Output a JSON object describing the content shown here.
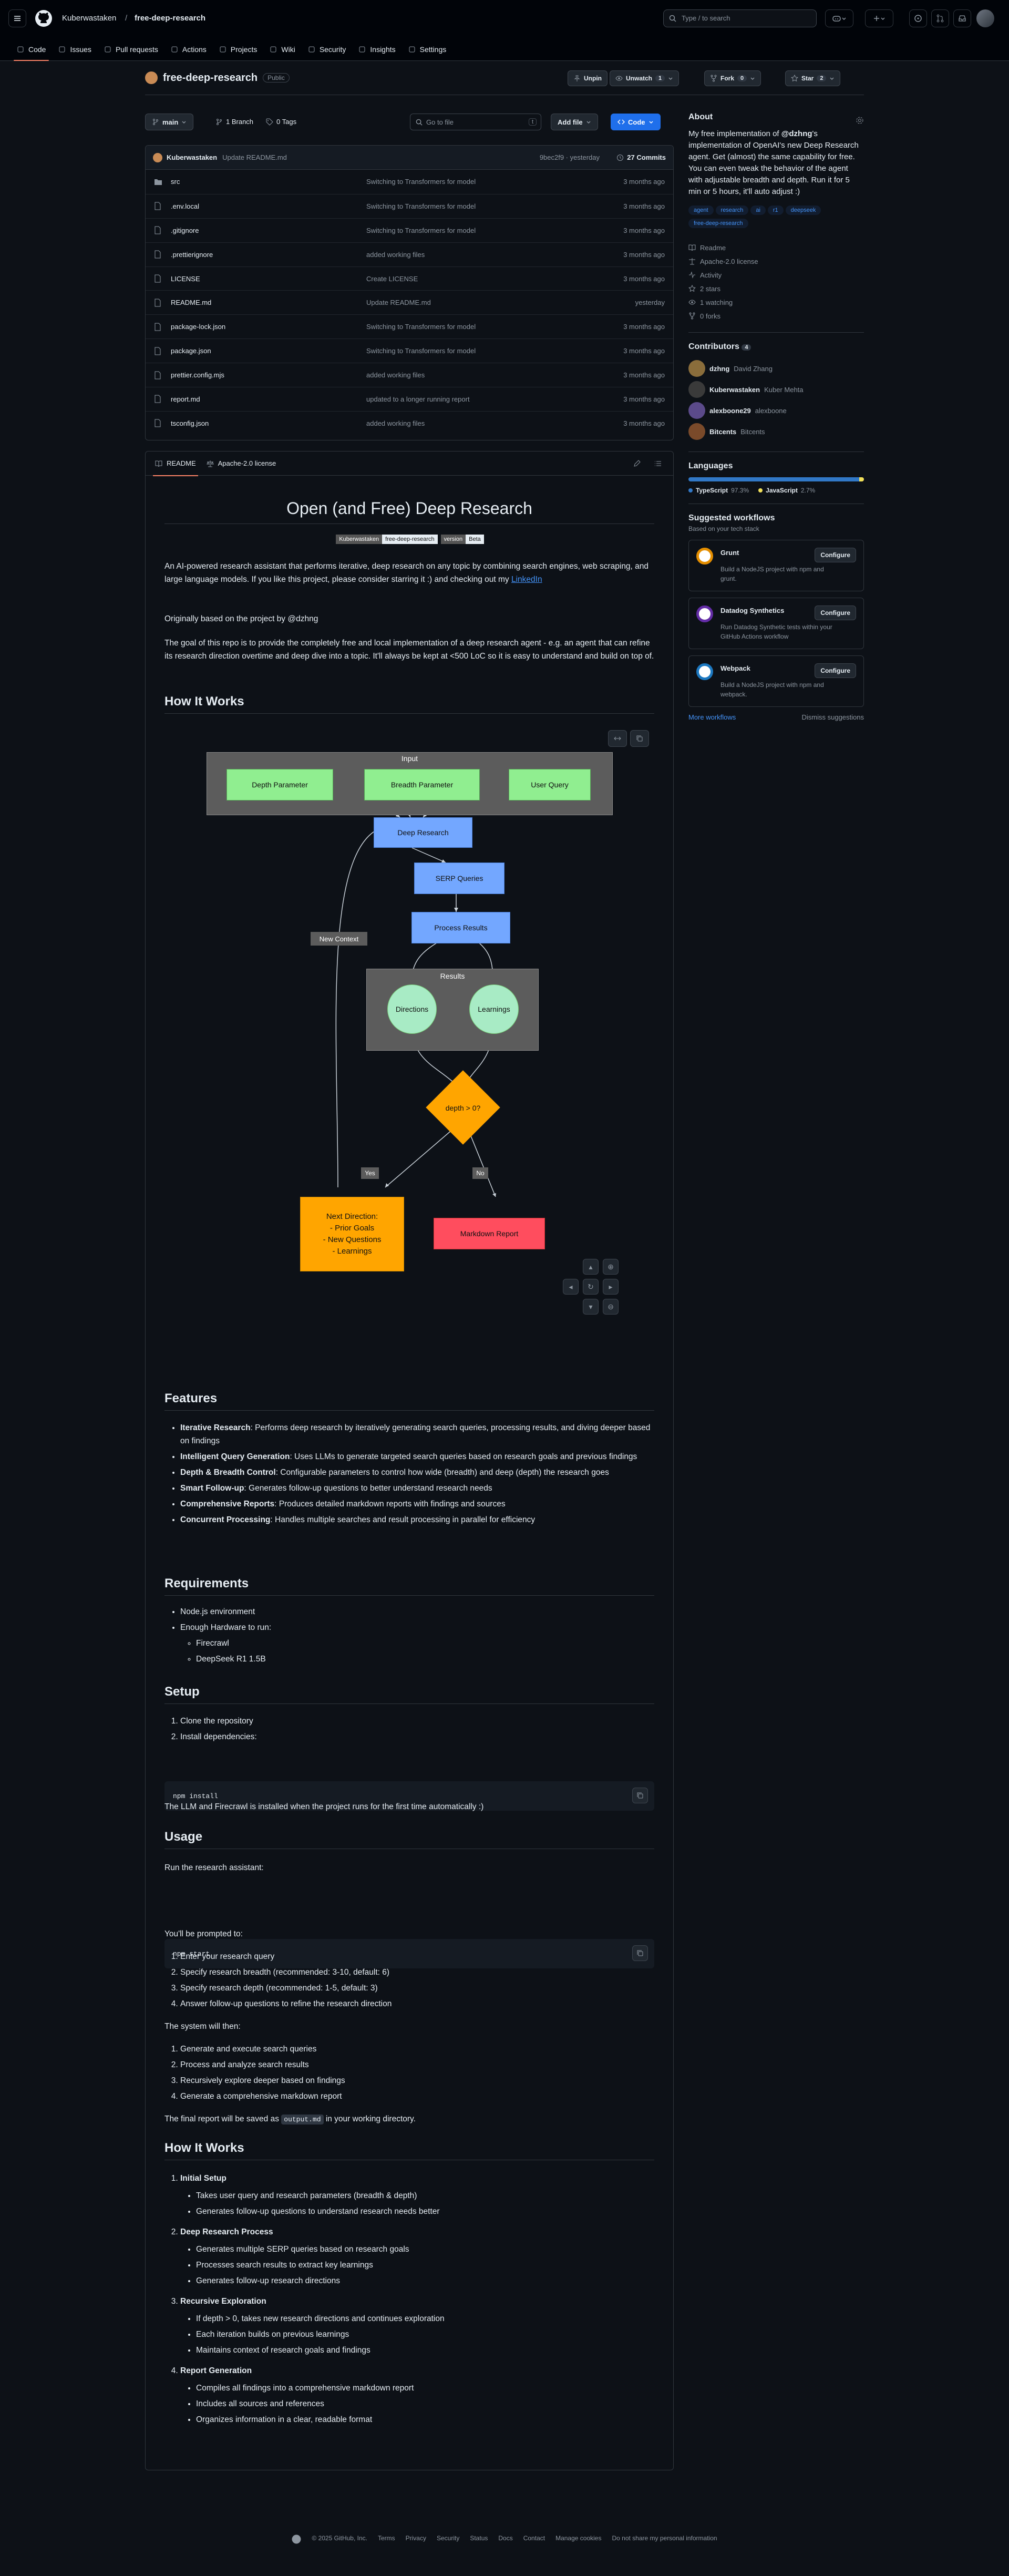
{
  "header": {
    "owner": "Kuberwastaken",
    "repo": "free-deep-research",
    "search_placeholder": "Type / to search",
    "tabs": [
      {
        "label": "Code",
        "icon": "code-icon"
      },
      {
        "label": "Issues",
        "icon": "issue-icon"
      },
      {
        "label": "Pull requests",
        "icon": "pull-request-icon"
      },
      {
        "label": "Actions",
        "icon": "play-icon"
      },
      {
        "label": "Projects",
        "icon": "table-icon"
      },
      {
        "label": "Wiki",
        "icon": "book-icon"
      },
      {
        "label": "Security",
        "icon": "shield-icon"
      },
      {
        "label": "Insights",
        "icon": "graph-icon"
      },
      {
        "label": "Settings",
        "icon": "gear-icon"
      }
    ]
  },
  "repo": {
    "name": "free-deep-research",
    "visibility": "Public",
    "unpin": "Unpin",
    "unwatch": "Unwatch",
    "watch_count": "1",
    "fork": "Fork",
    "fork_count": "0",
    "star": "Star",
    "star_count": "2"
  },
  "toolbar": {
    "branch": "main",
    "branches": "1 Branch",
    "tags": "0 Tags",
    "goto_placeholder": "Go to file",
    "goto_key": "t",
    "add_file": "Add file",
    "code": "Code"
  },
  "commit": {
    "author": "Kuberwastaken",
    "message": "Update README.md",
    "hash_time": "9bec2f9 · yesterday",
    "count": "27 Commits"
  },
  "files": [
    {
      "name": "src",
      "type": "folder",
      "msg": "Switching to Transformers for model",
      "date": "3 months ago"
    },
    {
      "name": ".env.local",
      "type": "file",
      "msg": "Switching to Transformers for model",
      "date": "3 months ago"
    },
    {
      "name": ".gitignore",
      "type": "file",
      "msg": "Switching to Transformers for model",
      "date": "3 months ago"
    },
    {
      "name": ".prettierignore",
      "type": "file",
      "msg": "added working files",
      "date": "3 months ago"
    },
    {
      "name": "LICENSE",
      "type": "file",
      "msg": "Create LICENSE",
      "date": "3 months ago"
    },
    {
      "name": "README.md",
      "type": "file",
      "msg": "Update README.md",
      "date": "yesterday"
    },
    {
      "name": "package-lock.json",
      "type": "file",
      "msg": "Switching to Transformers for model",
      "date": "3 months ago"
    },
    {
      "name": "package.json",
      "type": "file",
      "msg": "Switching to Transformers for model",
      "date": "3 months ago"
    },
    {
      "name": "prettier.config.mjs",
      "type": "file",
      "msg": "added working files",
      "date": "3 months ago"
    },
    {
      "name": "report.md",
      "type": "file",
      "msg": "updated to a longer running report",
      "date": "3 months ago"
    },
    {
      "name": "tsconfig.json",
      "type": "file",
      "msg": "added working files",
      "date": "3 months ago"
    }
  ],
  "readme": {
    "tab_readme": "README",
    "tab_license": "Apache-2.0 license",
    "title": "Open (and Free) Deep Research",
    "badge1_left": "Kuberwastaken",
    "badge1_right": "free-deep-research",
    "badge2_left": "version",
    "badge2_right": "Beta",
    "intro": "An AI-powered research assistant that performs iterative, deep research on any topic by combining search engines, web scraping, and large language models. If you like this project, please consider starring it :) and checking out my",
    "intro_link": "LinkedIn",
    "based": "Originally based on the project by @dzhng",
    "goal": "The goal of this repo is to provide the completely free and local implementation of a deep research agent - e.g. an agent that can refine its research direction overtime and deep dive into a topic. It'll always be kept at <500 LoC so it is easy to understand and build on top of.",
    "how_title": "How It Works",
    "diagram": {
      "input": "Input",
      "breadth_param": "Breadth Parameter",
      "depth_param": "Depth Parameter",
      "user_query": "User Query",
      "deep_research": "Deep Research",
      "serp": "SERP Queries",
      "process": "Process Results",
      "results": "Results",
      "directions": "Directions",
      "learnings": "Learnings",
      "depth_cond": "depth > 0?",
      "yes": "Yes",
      "no": "No",
      "next1": "Next Direction:",
      "next2": "- Prior Goals",
      "next3": "- New Questions",
      "next4": "- Learnings",
      "report": "Markdown Report",
      "new_context": "New Context"
    },
    "features_title": "Features",
    "features": [
      {
        "b": "Iterative Research",
        "t": ": Performs deep research by iteratively generating search queries, processing results, and diving deeper based on findings"
      },
      {
        "b": "Intelligent Query Generation",
        "t": ": Uses LLMs to generate targeted search queries based on research goals and previous findings"
      },
      {
        "b": "Depth & Breadth Control",
        "t": ": Configurable parameters to control how wide (breadth) and deep (depth) the research goes"
      },
      {
        "b": "Smart Follow-up",
        "t": ": Generates follow-up questions to better understand research needs"
      },
      {
        "b": "Comprehensive Reports",
        "t": ": Produces detailed markdown reports with findings and sources"
      },
      {
        "b": "Concurrent Processing",
        "t": ": Handles multiple searches and result processing in parallel for efficiency"
      }
    ],
    "req_title": "Requirements",
    "req1": "Node.js environment",
    "req2": "Enough Hardware to run:",
    "req2a": "Firecrawl",
    "req2b": "DeepSeek R1 1.5B",
    "setup_title": "Setup",
    "setup1": "Clone the repository",
    "setup2": "Install dependencies:",
    "code_install": "npm install",
    "setup_note": "The LLM and Firecrawl is installed when the project runs for the first time automatically :)",
    "usage_title": "Usage",
    "usage_run": "Run the research assistant:",
    "code_start": "npm start",
    "prompted": "You'll be prompted to:",
    "prompts": [
      "Enter your research query",
      "Specify research breadth (recommended: 3-10, default: 6)",
      "Specify research depth (recommended: 1-5, default: 3)",
      "Answer follow-up questions to refine the research direction"
    ],
    "system_will": "The system will then:",
    "system": [
      "Generate and execute search queries",
      "Process and analyze search results",
      "Recursively explore deeper based on findings",
      "Generate a comprehensive markdown report"
    ],
    "saved_pre": "The final report will be saved as",
    "saved_code": "output.md",
    "saved_post": "in your working directory.",
    "how2_title": "How It Works",
    "steps": [
      {
        "title": "Initial Setup",
        "items": [
          "Takes user query and research parameters (breadth & depth)",
          "Generates follow-up questions to understand research needs better"
        ]
      },
      {
        "title": "Deep Research Process",
        "items": [
          "Generates multiple SERP queries based on research goals",
          "Processes search results to extract key learnings",
          "Generates follow-up research directions"
        ]
      },
      {
        "title": "Recursive Exploration",
        "items": [
          "If depth > 0, takes new research directions and continues exploration",
          "Each iteration builds on previous learnings",
          "Maintains context of research goals and findings"
        ]
      },
      {
        "title": "Report Generation",
        "items": [
          "Compiles all findings into a comprehensive markdown report",
          "Includes all sources and references",
          "Organizes information in a clear, readable format"
        ]
      }
    ]
  },
  "about": {
    "title": "About",
    "desc_pre": "My free implementation of ",
    "desc_mention": "@dzhng",
    "desc_post": "'s implementation of OpenAI's new Deep Research agent. Get (almost) the same capability for free. You can even tweak the behavior of the agent with adjustable breadth and depth. Run it for 5 min or 5 hours, it'll auto adjust :)",
    "topics": [
      "agent",
      "research",
      "ai",
      "r1",
      "deepseek",
      "free-deep-research"
    ],
    "readme": "Readme",
    "license": "Apache-2.0 license",
    "activity": "Activity",
    "stars": "2 stars",
    "watching": "1 watching",
    "forks": "0 forks"
  },
  "contributors": {
    "title": "Contributors",
    "count": "4",
    "list": [
      {
        "login": "dzhng",
        "name": "David Zhang"
      },
      {
        "login": "Kuberwastaken",
        "name": "Kuber Mehta"
      },
      {
        "login": "alexboone29",
        "name": "alexboone"
      },
      {
        "login": "Bitcents",
        "name": "Bitcents"
      }
    ]
  },
  "languages": {
    "title": "Languages",
    "items": [
      {
        "name": "TypeScript",
        "pct": "97.3%",
        "color": "#3178c6",
        "value": 97.3
      },
      {
        "name": "JavaScript",
        "pct": "2.7%",
        "color": "#f1e05a",
        "value": 2.7
      }
    ]
  },
  "workflows": {
    "title": "Suggested workflows",
    "subtitle": "Based on your tech stack",
    "configure": "Configure",
    "list": [
      {
        "name": "Grunt",
        "desc": "Build a NodeJS project with npm and grunt."
      },
      {
        "name": "Datadog Synthetics",
        "desc": "Run Datadog Synthetic tests within your GitHub Actions workflow"
      },
      {
        "name": "Webpack",
        "desc": "Build a NodeJS project with npm and webpack."
      }
    ],
    "more": "More workflows",
    "dismiss": "Dismiss suggestions"
  },
  "footer": {
    "items": [
      "© 2025 GitHub, Inc.",
      "Terms",
      "Privacy",
      "Security",
      "Status",
      "Docs",
      "Contact",
      "Manage cookies",
      "Do not share my personal information"
    ]
  }
}
